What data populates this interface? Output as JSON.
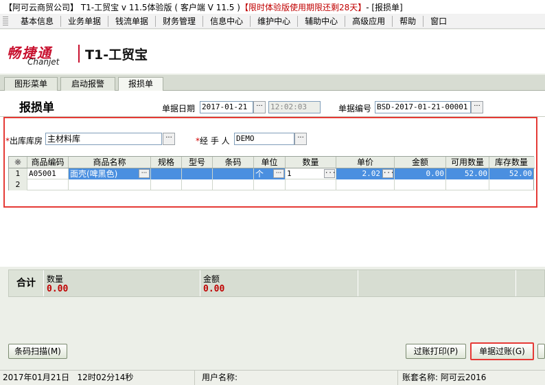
{
  "window": {
    "title_part1": "【阿可云商贸公司】 T1-工贸宝 v 11.5体验版 ( 客户端 V 11.5 ) ",
    "title_warning": "【限时体验版使用期限还剩28天】",
    "title_part2": " - [报损单]"
  },
  "menu": [
    "基本信息",
    "业务单据",
    "钱流单据",
    "财务管理",
    "信息中心",
    "维护中心",
    "辅助中心",
    "高级应用",
    "帮助",
    "窗口"
  ],
  "brand": {
    "logo_cn": "畅捷通",
    "logo_en": "Chanjet",
    "product_prefix": "T1",
    "product_suffix": "-工贸宝"
  },
  "tabs": [
    "图形菜单",
    "启动报警",
    "报损单"
  ],
  "form": {
    "title": "报损单",
    "date_label": "单据日期",
    "date_value": "2017-01-21",
    "time_value": "12:02:03",
    "no_label": "单据编号",
    "no_value": "BSD-2017-01-21-00001",
    "warehouse_label": "出库库房",
    "warehouse_value": "主材料库",
    "handler_label": "经 手 人",
    "handler_value": "DEMO",
    "required_mark": "*"
  },
  "grid": {
    "headers": [
      "❋",
      "商品编码",
      "商品名称",
      "规格",
      "型号",
      "条码",
      "单位",
      "数量",
      "单价",
      "金额",
      "可用数量",
      "库存数量"
    ],
    "rows": [
      {
        "no": "1",
        "code": "A05001",
        "name": "面壳(啤黑色)",
        "spec": "",
        "model": "",
        "barcode": "",
        "unit": "个",
        "qty": "1",
        "price": "2.02",
        "amount": "0.00",
        "available": "52.00",
        "stock": "52.00"
      },
      {
        "no": "2",
        "code": "",
        "name": "",
        "spec": "",
        "model": "",
        "barcode": "",
        "unit": "",
        "qty": "",
        "price": "",
        "amount": "",
        "available": "",
        "stock": ""
      }
    ]
  },
  "totals": {
    "label": "合计",
    "qty_label": "数量",
    "qty_value": "0.00",
    "amount_label": "金额",
    "amount_value": "0.00"
  },
  "buttons": {
    "scan": "条码扫描(M)",
    "print": "过账打印(P)",
    "post": "单据过账(G)"
  },
  "status": {
    "date": "2017年01月21日",
    "time": "12时02分14秒",
    "user_label": "用户名称:",
    "account_label": "账套名称:",
    "account_value": "阿可云2016"
  },
  "colors": {
    "accent_red": "#e53935",
    "selection": "#4a8fe0",
    "value_red": "#c00000"
  }
}
